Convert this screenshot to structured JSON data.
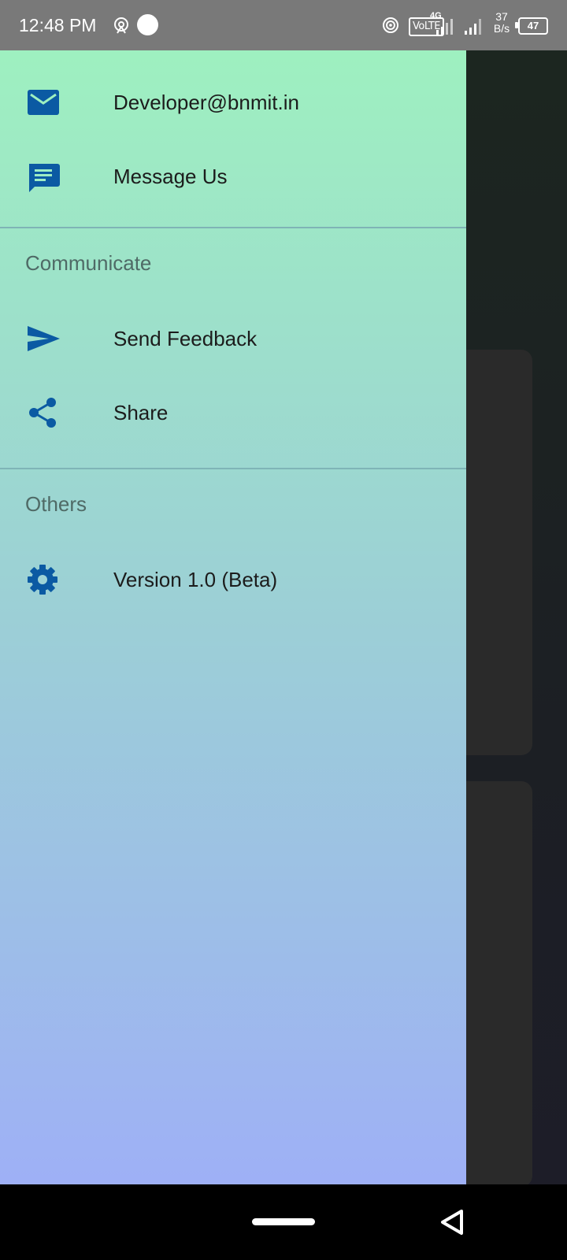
{
  "status_bar": {
    "time": "12:48 PM",
    "network_type": "4G",
    "volte_label": "VoLTE",
    "speed_value": "37",
    "speed_unit": "B/s",
    "battery_level": "47"
  },
  "drawer": {
    "items_top": [
      {
        "label": "Developer@bnmit.in",
        "icon": "mail-icon"
      },
      {
        "label": "Message Us",
        "icon": "message-icon"
      }
    ],
    "sections": [
      {
        "title": "Communicate",
        "items": [
          {
            "label": "Send Feedback",
            "icon": "send-icon"
          },
          {
            "label": "Share",
            "icon": "share-icon"
          }
        ]
      },
      {
        "title": "Others",
        "items": [
          {
            "label": "Version 1.0 (Beta)",
            "icon": "gear-icon"
          }
        ]
      }
    ]
  },
  "colors": {
    "icon_blue": "#0b5aa3",
    "drawer_top": "#9ef0c0",
    "drawer_bottom": "#9eb0f6"
  }
}
